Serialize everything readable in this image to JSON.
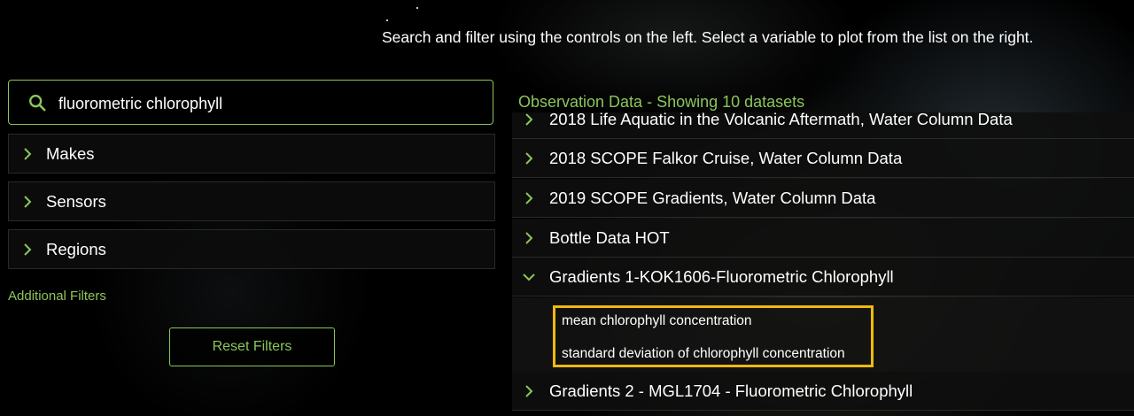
{
  "instructions": "Search and filter using the controls on the left. Select a variable to plot from the list on the right.",
  "search": {
    "value": "fluorometric chlorophyll",
    "icon": "search-icon"
  },
  "filters": [
    {
      "label": "Makes",
      "icon": "chevron-right-icon"
    },
    {
      "label": "Sensors",
      "icon": "chevron-right-icon"
    },
    {
      "label": "Regions",
      "icon": "chevron-right-icon"
    }
  ],
  "additional_filters_label": "Additional Filters",
  "reset_label": "Reset Filters",
  "observation": {
    "title": "Observation Data - Showing 10 datasets",
    "datasets": [
      {
        "label": "2018 Life Aquatic in the Volcanic Aftermath, Water Column Data",
        "expanded": false
      },
      {
        "label": "2018 SCOPE Falkor Cruise, Water Column Data",
        "expanded": false
      },
      {
        "label": "2019 SCOPE Gradients, Water Column Data",
        "expanded": false
      },
      {
        "label": "Bottle Data HOT",
        "expanded": false
      },
      {
        "label": "Gradients 1-KOK1606-Fluorometric Chlorophyll",
        "expanded": true
      },
      {
        "label": "Gradients 2 - MGL1704 - Fluorometric Chlorophyll",
        "expanded": false
      }
    ],
    "variables": [
      "mean chlorophyll concentration",
      "standard deviation of chlorophyll concentration"
    ]
  },
  "colors": {
    "accent": "#8bc65a",
    "highlight": "#f2b90c",
    "background": "#000000"
  }
}
